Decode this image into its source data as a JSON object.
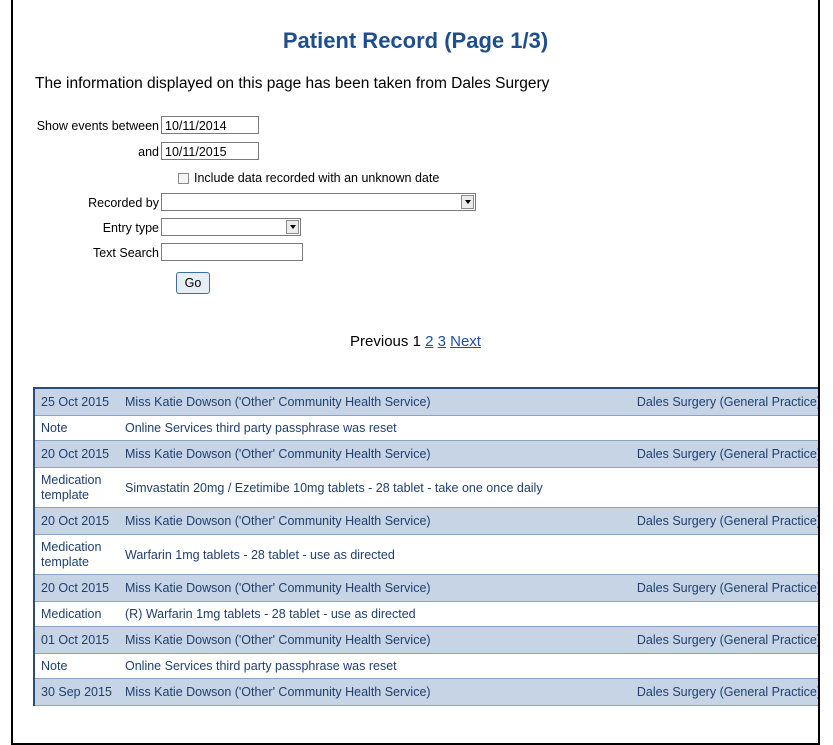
{
  "page": {
    "title": "Patient Record (Page 1/3)",
    "intro": "The information displayed on this page has been taken from Dales Surgery"
  },
  "filters": {
    "show_events_label": "Show events between",
    "from_value": "10/11/2014",
    "and_label": "and",
    "to_value": "10/11/2015",
    "unknown_date_label": "Include data recorded with an unknown date",
    "recorded_by_label": "Recorded by",
    "entry_type_label": "Entry type",
    "text_search_label": "Text Search",
    "text_search_value": "",
    "go_label": "Go"
  },
  "pager": {
    "previous": "Previous",
    "current": "1",
    "page2": "2",
    "page3": "3",
    "next": "Next"
  },
  "records": [
    {
      "date": "25 Oct 2015",
      "author": "Miss Katie Dowson ('Other' Community Health Service)",
      "org": "Dales Surgery (General Practice)",
      "type": "Note",
      "detail": "Online Services third party passphrase was reset"
    },
    {
      "date": "20 Oct 2015",
      "author": "Miss Katie Dowson ('Other' Community Health Service)",
      "org": "Dales Surgery (General Practice)",
      "type": "Medication template",
      "detail": "Simvastatin 20mg / Ezetimibe 10mg tablets - 28 tablet - take one once daily"
    },
    {
      "date": "20 Oct 2015",
      "author": "Miss Katie Dowson ('Other' Community Health Service)",
      "org": "Dales Surgery (General Practice)",
      "type": "Medication template",
      "detail": "Warfarin 1mg tablets - 28 tablet - use as directed"
    },
    {
      "date": "20 Oct 2015",
      "author": "Miss Katie Dowson ('Other' Community Health Service)",
      "org": "Dales Surgery (General Practice)",
      "type": "Medication",
      "detail": "(R) Warfarin 1mg tablets - 28 tablet - use as directed"
    },
    {
      "date": "01 Oct 2015",
      "author": "Miss Katie Dowson ('Other' Community Health Service)",
      "org": "Dales Surgery (General Practice)",
      "type": "Note",
      "detail": "Online Services third party passphrase was reset"
    },
    {
      "date": "30 Sep 2015",
      "author": "Miss Katie Dowson ('Other' Community Health Service)",
      "org": "Dales Surgery (General Practice)",
      "type": "",
      "detail": ""
    }
  ]
}
